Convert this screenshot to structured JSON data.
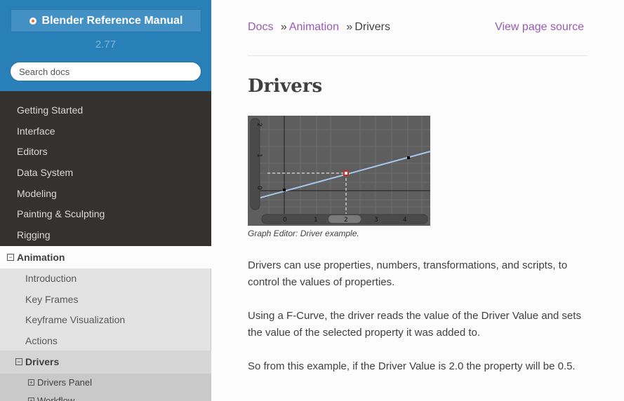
{
  "sidebar": {
    "logo_text": "Blender Reference Manual",
    "version": "2.77",
    "search_placeholder": "Search docs",
    "nav_items": [
      "Getting Started",
      "Interface",
      "Editors",
      "Data System",
      "Modeling",
      "Painting & Sculpting",
      "Rigging"
    ],
    "current": "Animation",
    "sub_items": [
      "Introduction",
      "Key Frames",
      "Keyframe Visualization",
      "Actions"
    ],
    "sub_current": "Drivers",
    "sub_sub_items": [
      "Drivers Panel",
      "Workflow"
    ]
  },
  "breadcrumbs": {
    "docs": "Docs",
    "sep": "»",
    "animation": "Animation",
    "current": "Drivers",
    "view_source": "View page source"
  },
  "page": {
    "title": "Drivers",
    "caption": "Graph Editor: Driver example.",
    "paragraphs": [
      "Drivers can use properties, numbers, transformations, and scripts, to control the values of properties.",
      "Using a F-Curve, the driver reads the value of the Driver Value and sets the value of the selected property it was added to.",
      "So from this example, if the Driver Value is 2.0 the property will be 0.5."
    ]
  },
  "graph": {
    "x_ticks": [
      "0",
      "1",
      "2",
      "3",
      "4"
    ],
    "y_ticks": [
      "0",
      "1",
      "2"
    ],
    "bg_color": "#5e5e5e",
    "curve_color": "#a9c9ee",
    "marker_color": "#d12a2a"
  },
  "colors": {
    "sidebar_top": "#2980b9",
    "sidebar_bg": "#343131",
    "link": "#2980b9",
    "breadcrumb_link": "#9b59b6",
    "text": "#404040"
  }
}
